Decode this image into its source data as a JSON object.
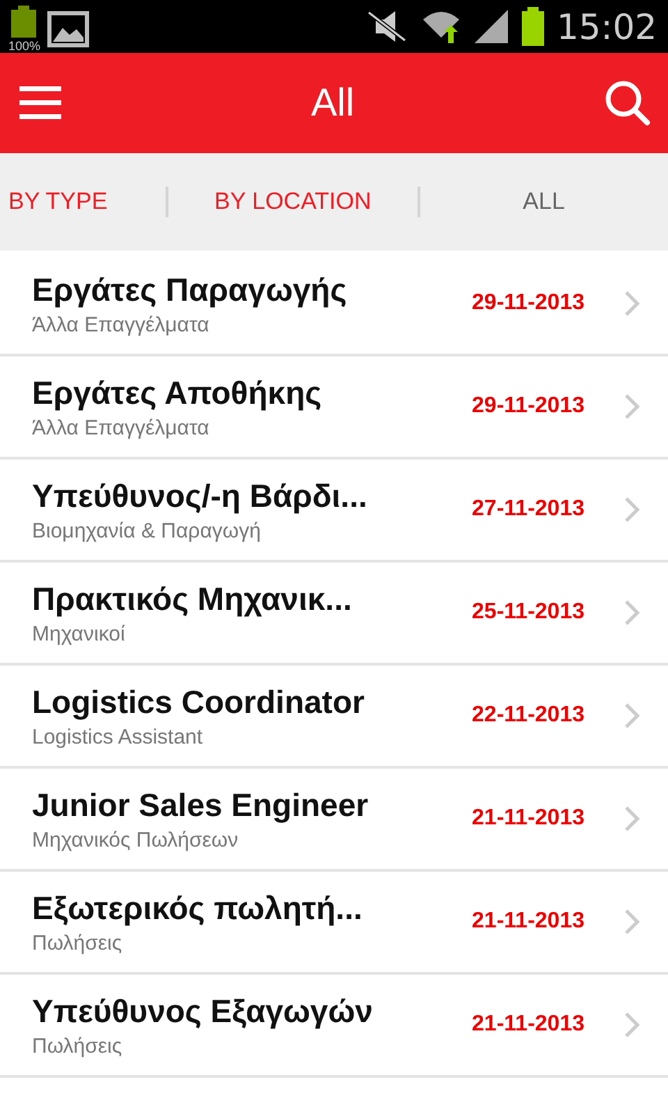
{
  "status_bar": {
    "battery_label": "100%",
    "time": "15:02"
  },
  "header": {
    "title": "All"
  },
  "tabs": [
    {
      "label": "BY TYPE",
      "selected": false
    },
    {
      "label": "BY LOCATION",
      "selected": false
    },
    {
      "label": "ALL",
      "selected": true
    }
  ],
  "jobs": [
    {
      "title": "Εργάτες Παραγωγής",
      "category": "Άλλα Επαγγέλματα",
      "date": "29-11-2013"
    },
    {
      "title": "Εργάτες Αποθήκης",
      "category": "Άλλα Επαγγέλματα",
      "date": "29-11-2013"
    },
    {
      "title": "Υπεύθυνος/-η Βάρδι...",
      "category": "Βιομηχανία & Παραγωγή",
      "date": "27-11-2013"
    },
    {
      "title": "Πρακτικός Μηχανικ...",
      "category": "Μηχανικοί",
      "date": "25-11-2013"
    },
    {
      "title": "Logistics Coordinator",
      "category": "Logistics Assistant",
      "date": "22-11-2013"
    },
    {
      "title": "Junior Sales Engineer",
      "category": "Μηχανικός Πωλήσεων",
      "date": "21-11-2013"
    },
    {
      "title": "Εξωτερικός πωλητή...",
      "category": "Πωλήσεις",
      "date": "21-11-2013"
    },
    {
      "title": "Υπεύθυνος Εξαγωγών",
      "category": "Πωλήσεις",
      "date": "21-11-2013"
    }
  ]
}
